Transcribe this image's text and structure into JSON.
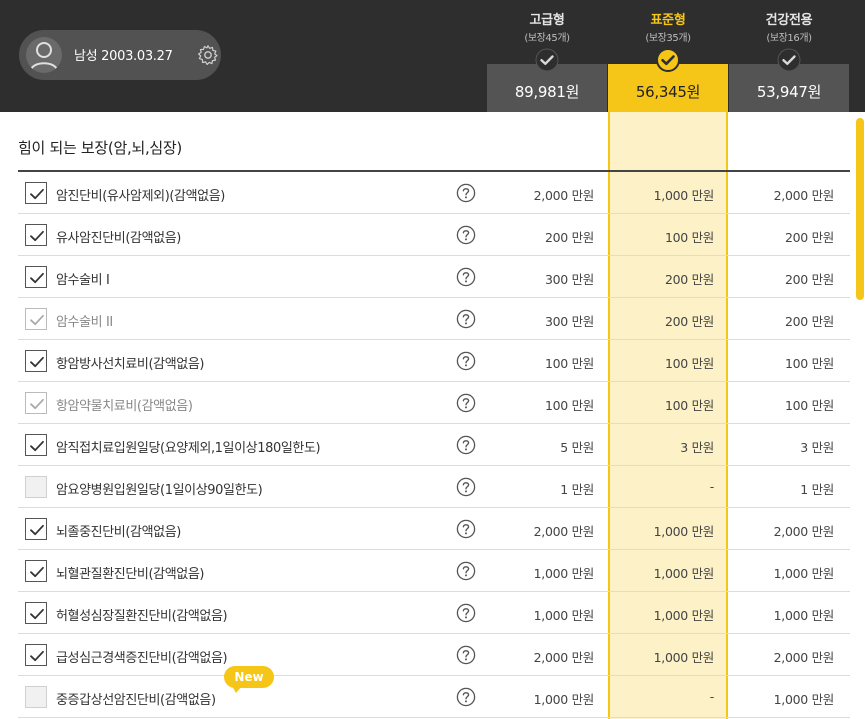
{
  "profile": {
    "text": "남성 2003.03.27"
  },
  "plans": [
    {
      "name": "고급형",
      "sub": "(보장45개)",
      "price": "89,981원",
      "selected": false
    },
    {
      "name": "표준형",
      "sub": "(보장35개)",
      "price": "56,345원",
      "selected": true
    },
    {
      "name": "건강전용",
      "sub": "(보장16개)",
      "price": "53,947원",
      "selected": false
    }
  ],
  "section": {
    "title": "힘이 되는 보장(암,뇌,심장)"
  },
  "badge": {
    "new_label": "New"
  },
  "rows": [
    {
      "label": "암진단비(유사암제외)(감액없음)",
      "state": "checked",
      "v1": "2,000 만원",
      "v2": "1,000 만원",
      "v3": "2,000 만원"
    },
    {
      "label": "유사암진단비(감액없음)",
      "state": "checked",
      "v1": "200 만원",
      "v2": "100 만원",
      "v3": "200 만원"
    },
    {
      "label": "암수술비 I",
      "state": "checked",
      "v1": "300 만원",
      "v2": "200 만원",
      "v3": "200 만원"
    },
    {
      "label": "암수술비 II",
      "state": "muted",
      "v1": "300 만원",
      "v2": "200 만원",
      "v3": "200 만원"
    },
    {
      "label": "항암방사선치료비(감액없음)",
      "state": "checked",
      "v1": "100 만원",
      "v2": "100 만원",
      "v3": "100 만원"
    },
    {
      "label": "항암약물치료비(감액없음)",
      "state": "muted",
      "v1": "100 만원",
      "v2": "100 만원",
      "v3": "100 만원"
    },
    {
      "label": "암직접치료입원일당(요양제외,1일이상180일한도)",
      "state": "checked",
      "v1": "5 만원",
      "v2": "3 만원",
      "v3": "3 만원"
    },
    {
      "label": "암요양병원입원일당(1일이상90일한도)",
      "state": "empty",
      "v1": "1 만원",
      "v2": "-",
      "v3": "1 만원"
    },
    {
      "label": "뇌졸중진단비(감액없음)",
      "state": "checked",
      "v1": "2,000 만원",
      "v2": "1,000 만원",
      "v3": "2,000 만원"
    },
    {
      "label": "뇌혈관질환진단비(감액없음)",
      "state": "checked",
      "v1": "1,000 만원",
      "v2": "1,000 만원",
      "v3": "1,000 만원"
    },
    {
      "label": "허혈성심장질환진단비(감액없음)",
      "state": "checked",
      "v1": "1,000 만원",
      "v2": "1,000 만원",
      "v3": "1,000 만원"
    },
    {
      "label": "급성심근경색증진단비(감액없음)",
      "state": "checked",
      "v1": "2,000 만원",
      "v2": "1,000 만원",
      "v3": "2,000 만원"
    },
    {
      "label": "중증갑상선암진단비(감액없음)",
      "state": "empty",
      "v1": "1,000 만원",
      "v2": "-",
      "v3": "1,000 만원",
      "new": true
    }
  ]
}
